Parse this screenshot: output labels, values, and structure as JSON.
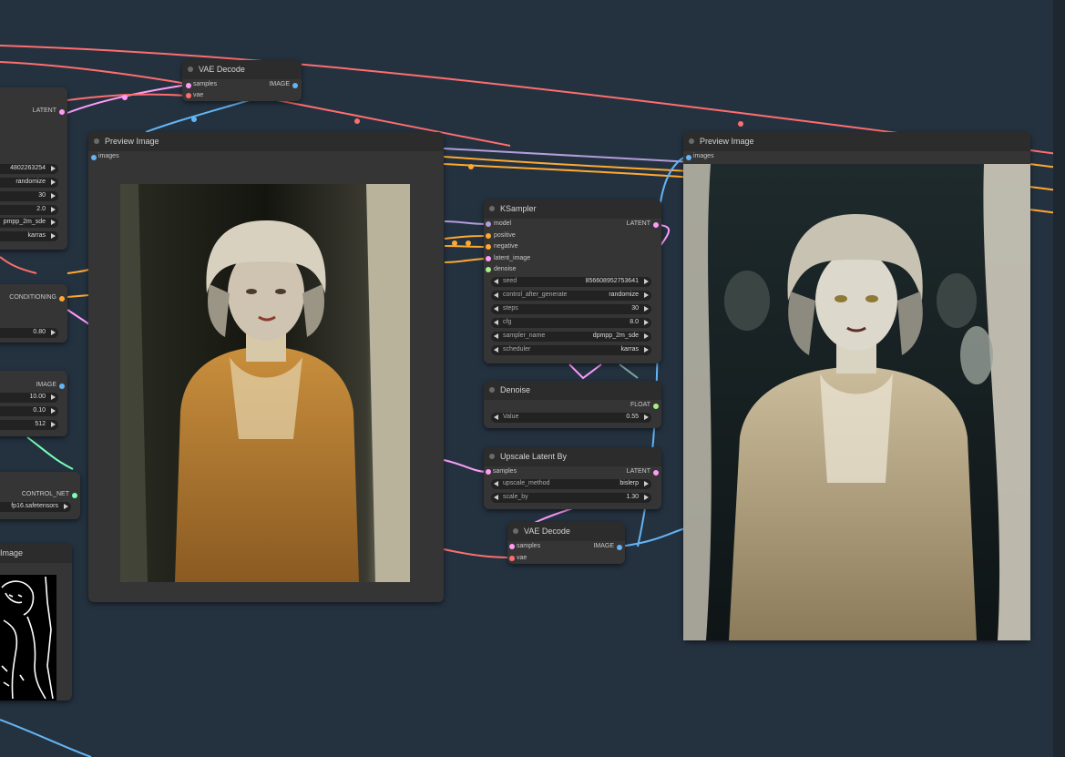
{
  "colors": {
    "canvas": "#243240",
    "node": "#353535",
    "node_title": "#2c2c2c",
    "latent": "#ff9cf9",
    "vae": "#ff6e6e",
    "image": "#64b5f6",
    "conditioning": "#ffa931",
    "float": "#aaee88",
    "control_net": "#7affb8",
    "model": "#b39ddb"
  },
  "vae_decode_top": {
    "title": "VAE Decode",
    "inputs": [
      "samples",
      "vae"
    ],
    "output": "IMAGE"
  },
  "left_partial": {
    "latent_out": "LATENT",
    "widgets": [
      "4802263254",
      "randomize",
      "30",
      "2.0",
      "pmpp_2m_sde",
      "karras"
    ],
    "conditioning_out": "CONDITIONING",
    "strength": "0.80",
    "image_out": "IMAGE",
    "canny": [
      "10.00",
      "0.10",
      "512"
    ],
    "control_net_out": "CONTROL_NET",
    "model_name": "fp16.safetensors",
    "preview_title": "Image"
  },
  "preview1": {
    "title": "Preview Image",
    "input": "images"
  },
  "ksampler": {
    "title": "KSampler",
    "inputs": [
      "model",
      "positive",
      "negative",
      "latent_image",
      "denoise"
    ],
    "output": "LATENT",
    "widgets": [
      {
        "name": "seed",
        "value": "856608952753641"
      },
      {
        "name": "control_after_generate",
        "value": "randomize"
      },
      {
        "name": "steps",
        "value": "30"
      },
      {
        "name": "cfg",
        "value": "8.0"
      },
      {
        "name": "sampler_name",
        "value": "dpmpp_2m_sde"
      },
      {
        "name": "scheduler",
        "value": "karras"
      }
    ]
  },
  "denoise": {
    "title": "Denoise",
    "output": "FLOAT",
    "widget": {
      "name": "Value",
      "value": "0.55"
    }
  },
  "upscale": {
    "title": "Upscale Latent By",
    "input": "samples",
    "output": "LATENT",
    "widgets": [
      {
        "name": "upscale_method",
        "value": "bislerp"
      },
      {
        "name": "scale_by",
        "value": "1.30"
      }
    ]
  },
  "vae_decode_bottom": {
    "title": "VAE Decode",
    "inputs": [
      "samples",
      "vae"
    ],
    "output": "IMAGE"
  },
  "preview2": {
    "title": "Preview Image",
    "input": "images"
  }
}
